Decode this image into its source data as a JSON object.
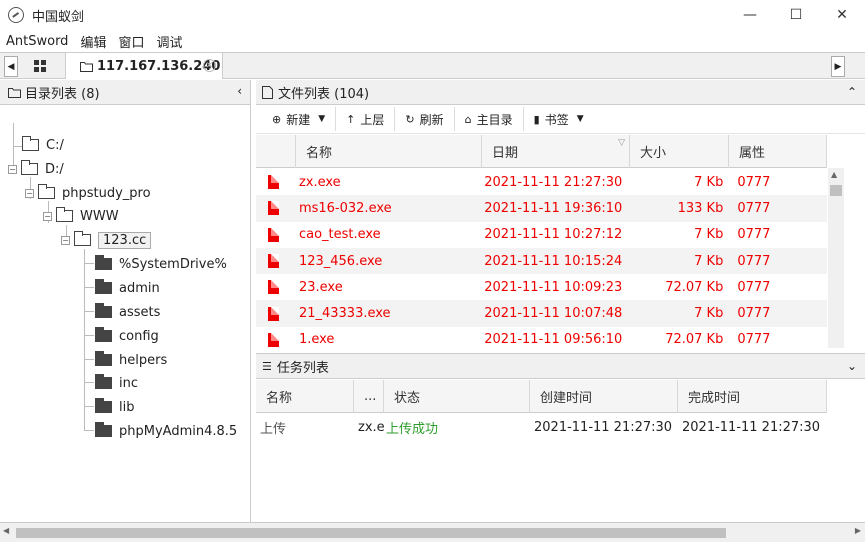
{
  "window": {
    "title": "中国蚁剑",
    "minimize": "—",
    "maximize": "☐",
    "close": "✕"
  },
  "menu": [
    "AntSword",
    "编辑",
    "窗口",
    "调试"
  ],
  "tabs": {
    "home_icon": "grid-icon",
    "active_label": "117.167.136.240",
    "left_arrow": "◀",
    "right_arrow": "▶"
  },
  "dir_panel": {
    "title": "目录列表 (8)",
    "tree": [
      {
        "label": "C:/",
        "level": 0,
        "toggle": ""
      },
      {
        "label": "D:/",
        "level": 0,
        "toggle": "−"
      },
      {
        "label": "phpstudy_pro",
        "level": 1,
        "toggle": "−"
      },
      {
        "label": "WWW",
        "level": 2,
        "toggle": "−"
      },
      {
        "label": "123.cc",
        "level": 3,
        "toggle": "−",
        "selected": true
      },
      {
        "label": "%SystemDrive%",
        "level": 4,
        "filled": true
      },
      {
        "label": "admin",
        "level": 4,
        "filled": true
      },
      {
        "label": "assets",
        "level": 4,
        "filled": true
      },
      {
        "label": "config",
        "level": 4,
        "filled": true
      },
      {
        "label": "helpers",
        "level": 4,
        "filled": true
      },
      {
        "label": "inc",
        "level": 4,
        "filled": true
      },
      {
        "label": "lib",
        "level": 4,
        "filled": true
      },
      {
        "label": "phpMyAdmin4.8.5",
        "level": 4,
        "filled": true
      }
    ]
  },
  "file_panel": {
    "title": "文件列表 (104)",
    "toolbar": {
      "new": "新建",
      "up": "上层",
      "refresh": "刷新",
      "home": "主目录",
      "bookmark": "书签"
    },
    "columns": {
      "name": "名称",
      "date": "日期",
      "size": "大小",
      "attr": "属性"
    },
    "files": [
      {
        "name": "zx.exe",
        "date": "2021-11-11 21:27:30",
        "size": "7 Kb",
        "attr": "0777"
      },
      {
        "name": "ms16-032.exe",
        "date": "2021-11-11 19:36:10",
        "size": "133 Kb",
        "attr": "0777"
      },
      {
        "name": "cao_test.exe",
        "date": "2021-11-11 10:27:12",
        "size": "7 Kb",
        "attr": "0777"
      },
      {
        "name": "123_456.exe",
        "date": "2021-11-11 10:15:24",
        "size": "7 Kb",
        "attr": "0777"
      },
      {
        "name": "23.exe",
        "date": "2021-11-11 10:09:23",
        "size": "72.07 Kb",
        "attr": "0777"
      },
      {
        "name": "21_43333.exe",
        "date": "2021-11-11 10:07:48",
        "size": "7 Kb",
        "attr": "0777"
      },
      {
        "name": "1.exe",
        "date": "2021-11-11 09:56:10",
        "size": "72.07 Kb",
        "attr": "0777"
      }
    ]
  },
  "task_panel": {
    "title": "任务列表",
    "columns": {
      "name": "名称",
      "more": "...",
      "status": "状态",
      "created": "创建时间",
      "finished": "完成时间"
    },
    "tasks": [
      {
        "name": "上传",
        "file": "zx.e",
        "status": "上传成功",
        "created": "2021-11-11 21:27:30",
        "finished": "2021-11-11 21:27:30"
      }
    ]
  },
  "colors": {
    "file_text": "#e00000",
    "success": "#2e9e2e"
  }
}
